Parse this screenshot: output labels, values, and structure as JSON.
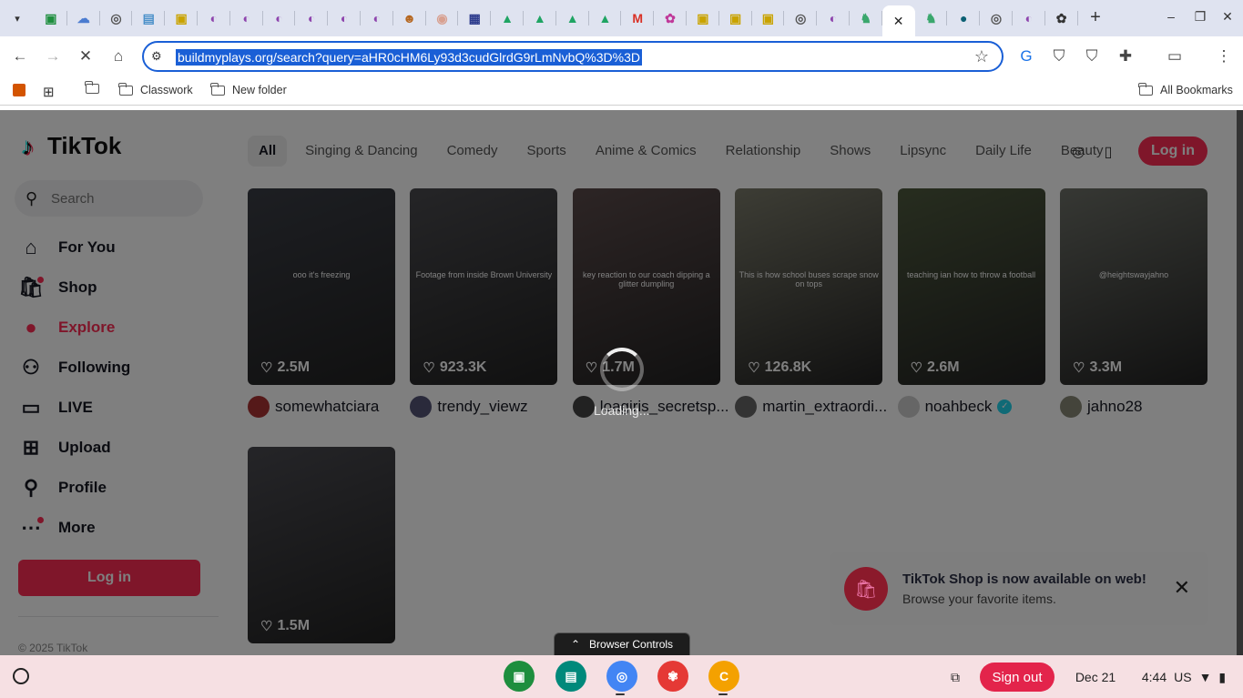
{
  "browser": {
    "tabs": [
      {
        "icon": "classroom-icon",
        "color": "#1e8e3e",
        "glyph": "▣"
      },
      {
        "icon": "cloud-icon",
        "color": "#4a7bd0",
        "glyph": "☁"
      },
      {
        "icon": "globe-icon",
        "color": "#555",
        "glyph": "◎"
      },
      {
        "icon": "doc-icon",
        "color": "#4a90c9",
        "glyph": "▤"
      },
      {
        "icon": "classroom-icon",
        "color": "#c9a300",
        "glyph": "▣"
      },
      {
        "icon": "planet-icon",
        "color": "#8e44ad",
        "glyph": "◐"
      },
      {
        "icon": "planet-icon",
        "color": "#8e44ad",
        "glyph": "◐"
      },
      {
        "icon": "planet-icon",
        "color": "#8e44ad",
        "glyph": "◐"
      },
      {
        "icon": "planet-icon",
        "color": "#8e44ad",
        "glyph": "◐"
      },
      {
        "icon": "planet-icon",
        "color": "#8e44ad",
        "glyph": "◐"
      },
      {
        "icon": "planet-icon",
        "color": "#8e44ad",
        "glyph": "◐"
      },
      {
        "icon": "character-icon",
        "color": "#b5651d",
        "glyph": "☻"
      },
      {
        "icon": "photo-icon",
        "color": "#d8a090",
        "glyph": "◉"
      },
      {
        "icon": "layout-icon",
        "color": "#2b3a8c",
        "glyph": "▦"
      },
      {
        "icon": "drive-icon",
        "color": "#1fa463",
        "glyph": "▲"
      },
      {
        "icon": "drive-icon",
        "color": "#1fa463",
        "glyph": "▲"
      },
      {
        "icon": "drive-icon",
        "color": "#1fa463",
        "glyph": "▲"
      },
      {
        "icon": "drive-icon",
        "color": "#1fa463",
        "glyph": "▲"
      },
      {
        "icon": "gmail-icon",
        "color": "#d93025",
        "glyph": "M"
      },
      {
        "icon": "jellyfish-icon",
        "color": "#c0399a",
        "glyph": "✿"
      },
      {
        "icon": "classroom-icon",
        "color": "#c9a300",
        "glyph": "▣"
      },
      {
        "icon": "classroom-icon",
        "color": "#c9a300",
        "glyph": "▣"
      },
      {
        "icon": "classroom-icon",
        "color": "#c9a300",
        "glyph": "▣"
      },
      {
        "icon": "globe-icon",
        "color": "#555",
        "glyph": "◎"
      },
      {
        "icon": "planet-icon",
        "color": "#8e44ad",
        "glyph": "◐"
      },
      {
        "icon": "figure-icon",
        "color": "#3aa76d",
        "glyph": "♞"
      },
      {
        "icon": "close-icon",
        "color": "#222",
        "glyph": "✕",
        "active": true
      },
      {
        "icon": "figure-icon",
        "color": "#3aa76d",
        "glyph": "♞"
      },
      {
        "icon": "app-icon",
        "color": "#0b5f73",
        "glyph": "●"
      },
      {
        "icon": "globe-icon",
        "color": "#555",
        "glyph": "◎"
      },
      {
        "icon": "planet-icon",
        "color": "#8e44ad",
        "glyph": "◐"
      },
      {
        "icon": "openai-icon",
        "color": "#333",
        "glyph": "✿"
      }
    ],
    "url": "buildmyplays.org/search?query=aHR0cHM6Ly93d3cudGlrdG9rLmNvbQ%3D%3D",
    "bookmarks": {
      "items": [
        "Classwork",
        "New folder"
      ],
      "all_bookmarks": "All Bookmarks"
    }
  },
  "tiktok": {
    "brand": "TikTok",
    "search_placeholder": "Search",
    "nav": [
      {
        "label": "For You",
        "icon": "home-icon",
        "glyph": "⌂"
      },
      {
        "label": "Shop",
        "icon": "shop-bag-icon",
        "glyph": "🛍",
        "dot": true
      },
      {
        "label": "Explore",
        "icon": "compass-icon",
        "glyph": "●",
        "active": true
      },
      {
        "label": "Following",
        "icon": "following-icon",
        "glyph": "⚇"
      },
      {
        "label": "LIVE",
        "icon": "live-tv-icon",
        "glyph": "▭"
      },
      {
        "label": "Upload",
        "icon": "upload-icon",
        "glyph": "⊞"
      },
      {
        "label": "Profile",
        "icon": "profile-icon",
        "glyph": "⚲"
      },
      {
        "label": "More",
        "icon": "more-icon",
        "glyph": "⋯",
        "dot": true
      }
    ],
    "login_label": "Log in",
    "copyright": "© 2025 TikTok",
    "categories": [
      "All",
      "Singing & Dancing",
      "Comedy",
      "Sports",
      "Anime & Comics",
      "Relationship",
      "Shows",
      "Lipsync",
      "Daily Life",
      "Beauty"
    ],
    "top_login_label": "Log in",
    "videos": [
      {
        "likes": "2.5M",
        "user": "somewhatciara",
        "caption": "ooo it's freezing",
        "bg": "#3a3d45",
        "avatar": "#a33"
      },
      {
        "likes": "923.3K",
        "user": "trendy_viewz",
        "caption": "Footage from inside Brown University",
        "bg": "#4a4a4e",
        "avatar": "#557"
      },
      {
        "likes": "1.7M",
        "user": "loagiris_secretsp...",
        "caption": "key reaction to our coach dipping a glitter dumpling",
        "bg": "#5a4a4a",
        "avatar": "#444"
      },
      {
        "likes": "126.8K",
        "user": "martin_extraordi...",
        "caption": "This is how school buses scrape snow on tops",
        "bg": "#7a7a6a",
        "avatar": "#666"
      },
      {
        "likes": "2.6M",
        "user": "noahbeck",
        "caption": "teaching ian how to throw a football",
        "bg": "#4e5a3e",
        "avatar": "#ccc",
        "verified": true
      },
      {
        "likes": "3.3M",
        "user": "jahno28",
        "caption": "@heightswayjahno",
        "bg": "#6d7068",
        "avatar": "#887"
      },
      {
        "likes": "1.5M",
        "user": "",
        "caption": "",
        "bg": "#4a4a50",
        "avatar": ""
      }
    ],
    "loading_text": "Loading...",
    "toast": {
      "title": "TikTok Shop is now available on web!",
      "subtitle": "Browse your favorite items."
    }
  },
  "browser_controls_label": "Browser Controls",
  "shelf": {
    "apps": [
      {
        "name": "classroom-app",
        "color": "#1e8e3e",
        "glyph": "▣"
      },
      {
        "name": "meet-app",
        "color": "#00897b",
        "glyph": "▤"
      },
      {
        "name": "chrome-app",
        "color": "#4285f4",
        "glyph": "◎"
      },
      {
        "name": "paint-app",
        "color": "#e53935",
        "glyph": "✾"
      },
      {
        "name": "c-app",
        "color": "#f4a100",
        "glyph": "C"
      }
    ],
    "sign_out": "Sign out",
    "date": "Dec 21",
    "time": "4:44",
    "locale": "US"
  }
}
